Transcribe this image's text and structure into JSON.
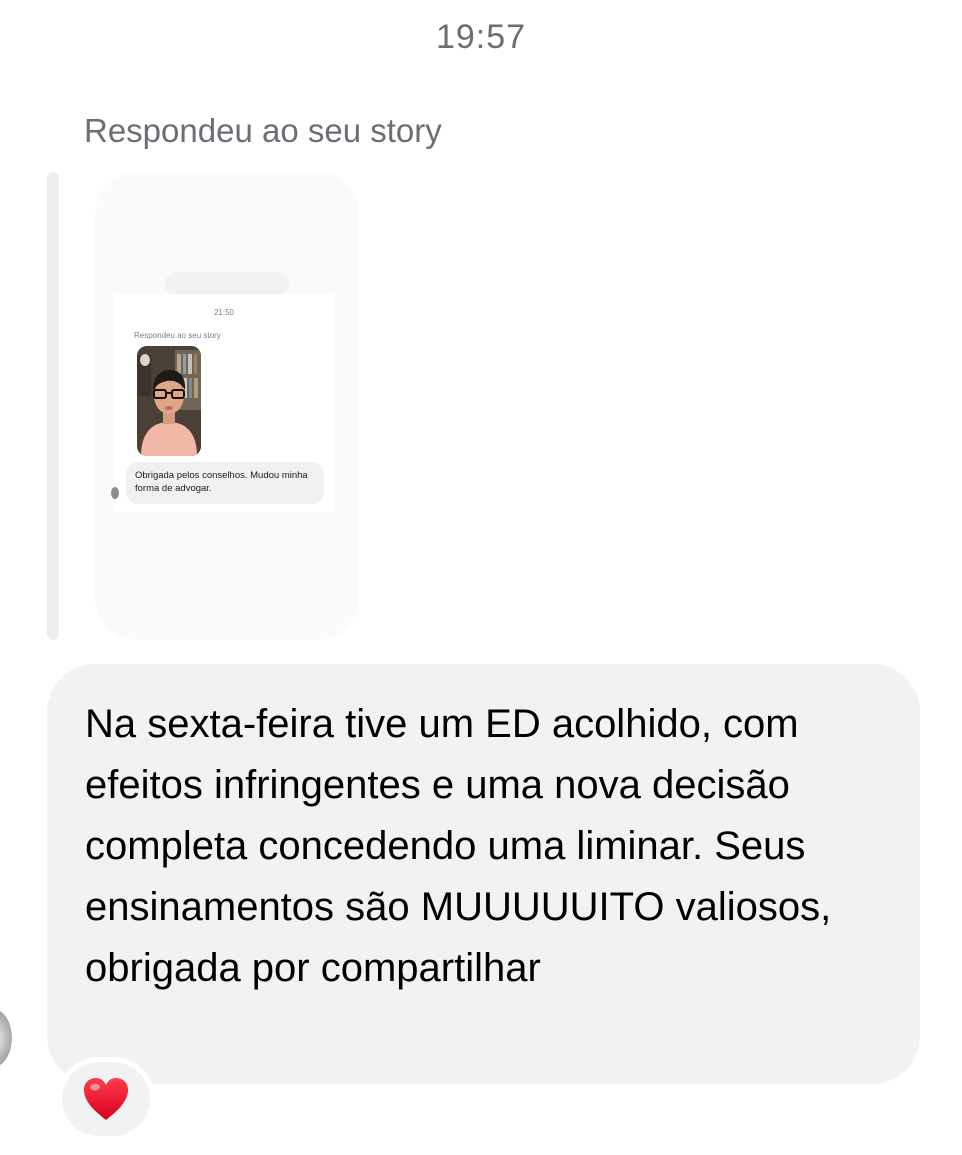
{
  "header": {
    "timestamp": "19:57"
  },
  "story_reply": {
    "label": "Respondeu ao seu story",
    "thumbnail": {
      "time": "21:50",
      "label": "Respondeu ao seu story",
      "message": "Obrigada pelos conselhos. Mudou minha forma de advogar."
    }
  },
  "message": {
    "text": "Na sexta-feira tive um ED acolhido, com efeitos infringentes e uma nova decisão completa concedendo uma liminar. Seus ensinamentos são MUUUUUITO valiosos, obrigada por compartilhar"
  },
  "reaction": {
    "icon": "heart-icon",
    "color": "#e0245e"
  },
  "colors": {
    "bubble": "#f1f2f4",
    "muted_text": "#6b6e74"
  }
}
